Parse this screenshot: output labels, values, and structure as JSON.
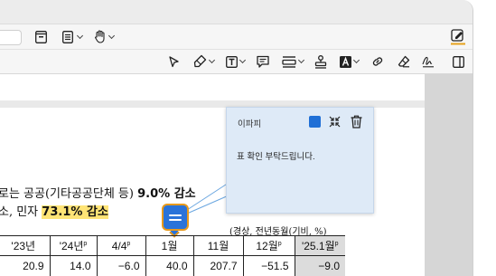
{
  "popup": {
    "author": "이파피",
    "color": "#1f6fd6",
    "text": "표 확인 부탁드립니다."
  },
  "document": {
    "line1_start": "로는 공공(기타공공단체 등)",
    "line1_value": "9.0% 감소",
    "line2_start": "소, 민자",
    "line2_value": "73.1% 감소",
    "unit_note": "(경상, 전년동월(기비, %)",
    "table": {
      "headers": [
        "'23년",
        "'24년",
        "4/4",
        "1월",
        "11월",
        "12월",
        "'25.1월"
      ],
      "header_sup": [
        "",
        "p",
        "p",
        "",
        "",
        "p",
        "p"
      ],
      "values": [
        "20.9",
        "14.0",
        "−6.0",
        "40.0",
        "207.7",
        "−51.5",
        "−9.0"
      ]
    }
  },
  "icons": {
    "toolbar_top": [
      "sidebar-panel-icon",
      "list-view-icon",
      "hand-tool-icon",
      "edit-pencil-icon"
    ],
    "toolbar_annot": [
      "pointer-icon",
      "highlighter-icon",
      "text-box-icon",
      "comment-icon",
      "field-icon",
      "stamp-icon",
      "text-color-icon",
      "link-icon",
      "eraser-icon",
      "signature-icon",
      "panel-toggle-icon"
    ],
    "popup": [
      "color-swatch",
      "collapse-icon",
      "trash-icon"
    ]
  }
}
